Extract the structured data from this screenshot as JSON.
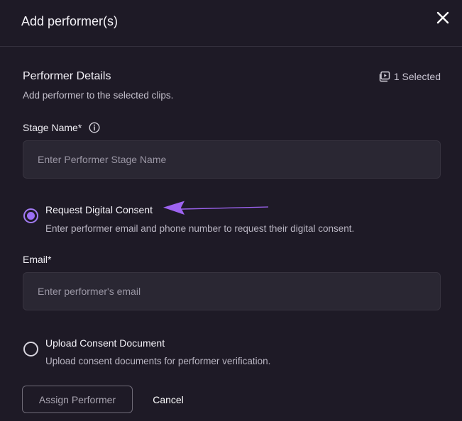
{
  "dialog": {
    "title": "Add performer(s)"
  },
  "details": {
    "title": "Performer Details",
    "description": "Add performer to the selected clips.",
    "selected_count": "1 Selected"
  },
  "stage_name": {
    "label": "Stage Name",
    "required_marker": "*",
    "placeholder": "Enter Performer Stage Name",
    "value": ""
  },
  "consent_options": [
    {
      "title": "Request Digital Consent",
      "description": "Enter performer email and phone number to request their digital consent.",
      "selected": true
    },
    {
      "title": "Upload Consent Document",
      "description": "Upload consent documents for performer verification.",
      "selected": false
    }
  ],
  "email": {
    "label": "Email",
    "required_marker": "*",
    "placeholder": "Enter performer's email",
    "value": ""
  },
  "actions": {
    "assign_label": "Assign Performer",
    "cancel_label": "Cancel"
  },
  "colors": {
    "background": "#1e1a26",
    "input_background": "#2a2733",
    "accent": "#9b6ef4",
    "arrow": "#9d63f0"
  },
  "icons": {
    "close": "close-icon",
    "clips": "clip-icon",
    "info": "info-icon",
    "annotation": "annotation-arrow"
  }
}
